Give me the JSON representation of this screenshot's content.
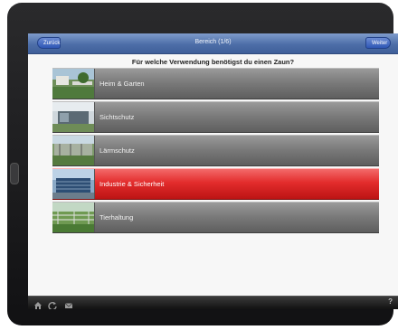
{
  "navbar": {
    "back_label": "Zurück",
    "title": "Bereich (1/6)",
    "next_label": "Weiter"
  },
  "question": "Für welche Verwendung benötigst du einen Zaun?",
  "options": [
    {
      "label": "Heim & Garten",
      "selected": false
    },
    {
      "label": "Sichtschutz",
      "selected": false
    },
    {
      "label": "Lärmschutz",
      "selected": false
    },
    {
      "label": "Industrie & Sicherheit",
      "selected": true
    },
    {
      "label": "Tierhaltung",
      "selected": false
    }
  ],
  "toolbar": {
    "icons": [
      "home-icon",
      "refresh-icon",
      "mail-icon"
    ],
    "help_label": "?"
  },
  "colors": {
    "nav_blue": "#4d6ea8",
    "selected_red": "#e32c2c",
    "row_gray": "#7b7b7b"
  }
}
